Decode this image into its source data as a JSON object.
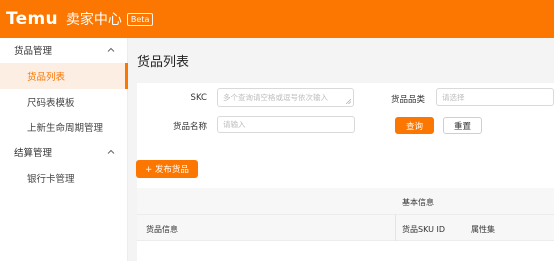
{
  "header": {
    "brand": "Temu",
    "title": "卖家中心",
    "badge": "Beta"
  },
  "sidebar": {
    "groups": [
      {
        "label": "货品管理",
        "items": [
          {
            "label": "货品列表",
            "active": true
          },
          {
            "label": "尺码表模板"
          },
          {
            "label": "上新生命周期管理"
          }
        ]
      },
      {
        "label": "结算管理",
        "items": [
          {
            "label": "银行卡管理"
          }
        ]
      }
    ]
  },
  "page": {
    "title": "货品列表"
  },
  "filters": {
    "skc_label": "SKC",
    "skc_placeholder": "多个查询请空格或逗号依次输入",
    "category_label": "货品品类",
    "category_placeholder": "请选择",
    "name_label": "货品名称",
    "name_placeholder": "请输入",
    "search_label": "查询",
    "reset_label": "重置"
  },
  "actions": {
    "publish_label": "+ 发布货品"
  },
  "table": {
    "group_header": "基本信息",
    "columns": [
      "货品信息",
      "货品SKU ID",
      "属性集"
    ]
  },
  "colors": {
    "accent": "#fb7701",
    "active_bg": "#fdeee4"
  }
}
